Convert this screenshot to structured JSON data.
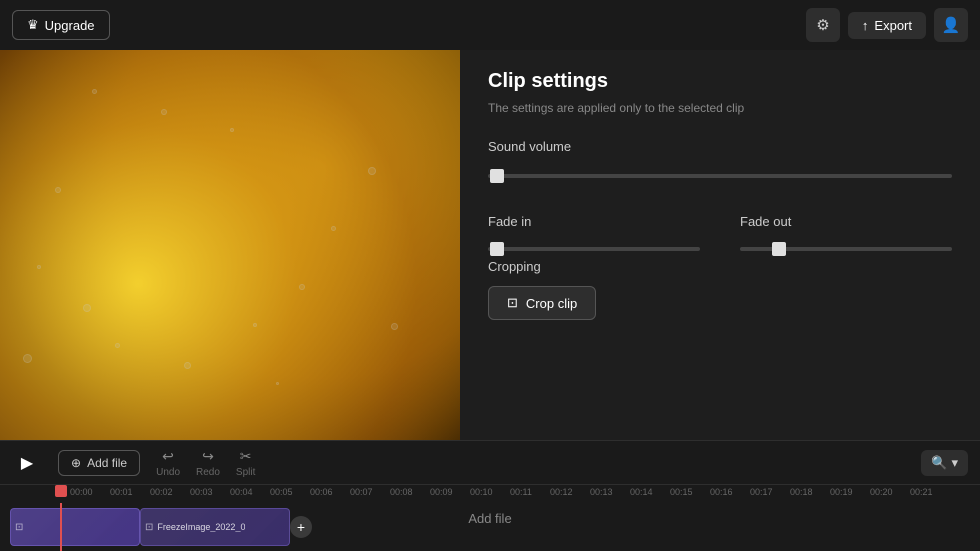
{
  "topbar": {
    "upgrade_label": "Upgrade",
    "export_label": "Export",
    "settings_icon": "⚙",
    "upload_icon": "↑",
    "user_icon": "👤"
  },
  "clip_settings": {
    "title": "Clip settings",
    "subtitle": "The settings are applied only to the selected clip",
    "sound_volume_label": "Sound volume",
    "fade_in_label": "Fade in",
    "fade_out_label": "Fade out",
    "cropping_label": "Cropping",
    "crop_btn_label": "Crop clip"
  },
  "timeline": {
    "add_file_label": "Add file",
    "undo_label": "Undo",
    "redo_label": "Redo",
    "split_label": "Split",
    "add_file_track_label": "Add file",
    "clip1_label": "",
    "clip2_label": "FreezeImage_2022_0",
    "ruler": [
      "00:00",
      "00:01",
      "00:02",
      "00:03",
      "00:04",
      "00:05",
      "00:06",
      "00:07",
      "00:08",
      "00:09",
      "00:10",
      "00:11",
      "00:12",
      "00:13",
      "00:14",
      "00:15",
      "00:16",
      "00:17",
      "00:18",
      "00:19",
      "00:20",
      "00:21"
    ]
  }
}
